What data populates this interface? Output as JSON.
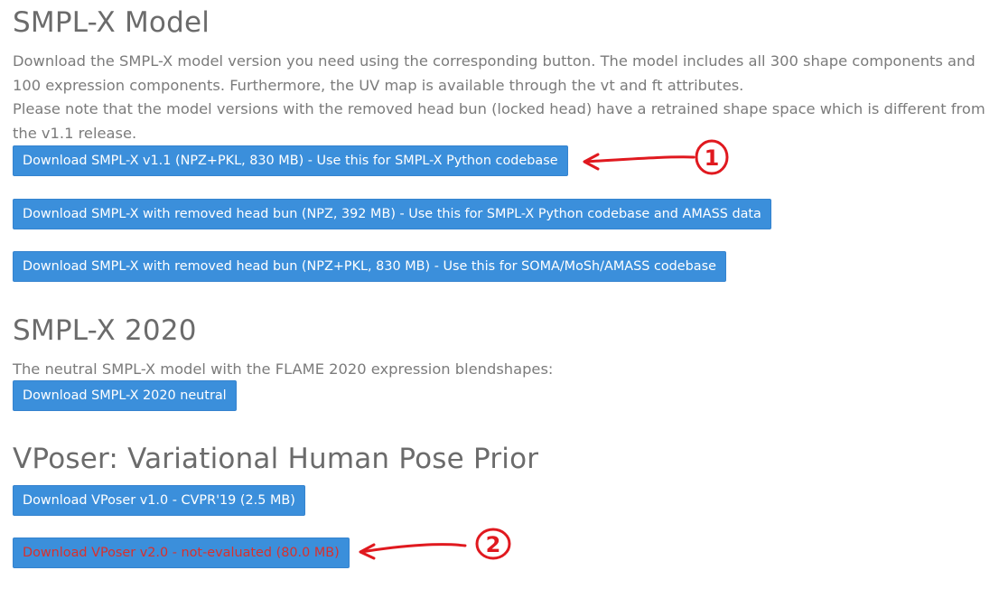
{
  "smplx": {
    "heading": "SMPL-X Model",
    "desc_lines": [
      "Download the SMPL-X model version you need using the corresponding button. The model includes all 300 shape components and",
      "100 expression components. Furthermore, the UV map is available through the vt and ft attributes.",
      "Please note that the model versions with the removed head bun (locked head) have a retrained shape space which is different from",
      "the v1.1 release."
    ],
    "buttons": [
      "Download SMPL-X v1.1 (NPZ+PKL, 830 MB) - Use this for SMPL-X Python codebase",
      "Download SMPL-X with removed head bun (NPZ, 392 MB) - Use this for SMPL-X Python codebase and AMASS data",
      "Download SMPL-X with removed head bun (NPZ+PKL, 830 MB) - Use this for SOMA/MoSh/AMASS codebase"
    ]
  },
  "smplx2020": {
    "heading": "SMPL-X 2020",
    "desc": "The neutral SMPL-X model with the FLAME 2020 expression blendshapes:",
    "button": "Download SMPL-X 2020 neutral"
  },
  "vposer": {
    "heading": "VPoser: Variational Human Pose Prior",
    "buttons": [
      "Download VPoser v1.0 - CVPR'19 (2.5 MB)",
      "Download VPoser v2.0 - not-evaluated (80.0 MB)"
    ]
  },
  "annotations": {
    "color": "#e0191f",
    "marker_1": "1",
    "marker_2": "2"
  }
}
